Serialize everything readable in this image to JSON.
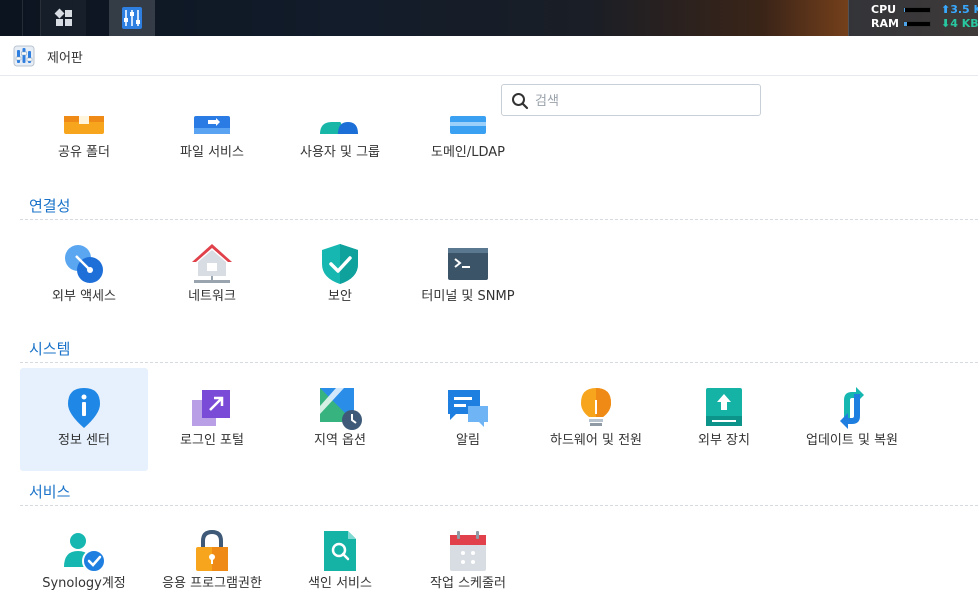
{
  "taskbar": {
    "cpu_label": "CPU",
    "ram_label": "RAM",
    "upload": "3.5 K",
    "download": "4 KB/",
    "cpu_level": 0.05,
    "ram_level": 0.12
  },
  "window": {
    "title": "제어판"
  },
  "search": {
    "placeholder": "검색"
  },
  "top_row": [
    {
      "label": "공유 폴더"
    },
    {
      "label": "파일 서비스"
    },
    {
      "label": "사용자 및 그룹"
    },
    {
      "label": "도메인/LDAP"
    }
  ],
  "sections": [
    {
      "title": "연결성",
      "items": [
        {
          "label": "외부 액세스"
        },
        {
          "label": "네트워크"
        },
        {
          "label": "보안"
        },
        {
          "label": "터미널 및 SNMP"
        }
      ]
    },
    {
      "title": "시스템",
      "items": [
        {
          "label": "정보 센터"
        },
        {
          "label": "로그인 포털"
        },
        {
          "label": "지역 옵션"
        },
        {
          "label": "알림"
        },
        {
          "label": "하드웨어 및 전원"
        },
        {
          "label": "외부 장치"
        },
        {
          "label": "업데이트 및 복원"
        }
      ]
    },
    {
      "title": "서비스",
      "items": [
        {
          "label": "Synology계정"
        },
        {
          "label": "응용 프로그램권한"
        },
        {
          "label": "색인 서비스"
        },
        {
          "label": "작업 스케줄러"
        }
      ]
    }
  ],
  "colors": {
    "section_title": "#1a73c9",
    "selected_bg": "#e6f1fd",
    "accent_blue": "#1f87e5"
  }
}
